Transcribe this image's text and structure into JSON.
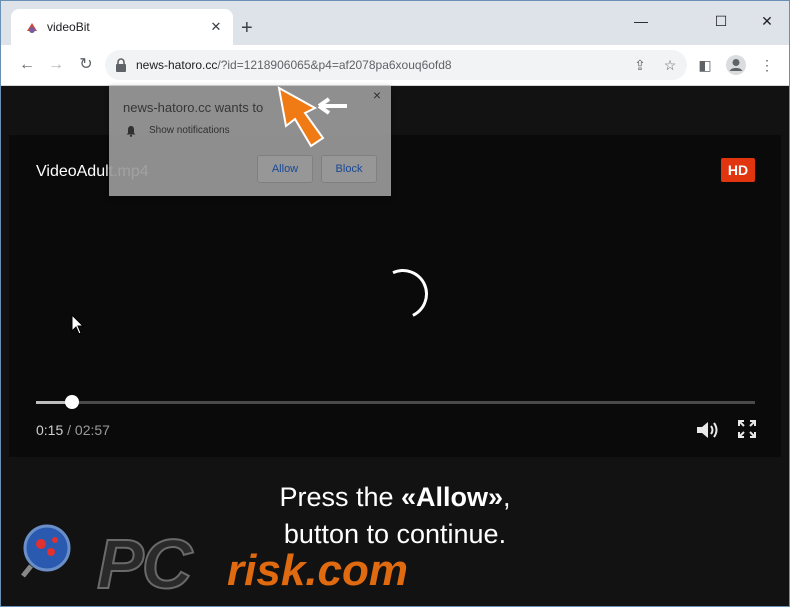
{
  "browser": {
    "tab_title": "videoBit",
    "tab_close": "✕",
    "new_tab": "+",
    "window_controls": {
      "minimize": "—",
      "maximize": "☐",
      "close": "✕"
    },
    "url_host": "news-hatoro.cc",
    "url_rest": "/?id=1218906065&p4=af2078pa6xouq6ofd8"
  },
  "popup": {
    "title": "news-hatoro.cc wants to",
    "permission": "Show notifications",
    "allow_label": "Allow",
    "block_label": "Block",
    "close": "×"
  },
  "player": {
    "title": "VideoAdult.mp4",
    "hd_badge": "HD",
    "current_time": "0:15",
    "separator": " / ",
    "duration": "02:57",
    "progress": 0.05
  },
  "instruction": {
    "line1_pre": "Press the ",
    "line1_bold": "«Allow»",
    "line1_post": ",",
    "line2": "button to continue."
  },
  "watermark": {
    "pc": "PC",
    "risk": "risk.com"
  },
  "colors": {
    "hd_badge": "#e0350f",
    "arrow": "#f07a14",
    "watermark_accent": "#e06a10"
  }
}
